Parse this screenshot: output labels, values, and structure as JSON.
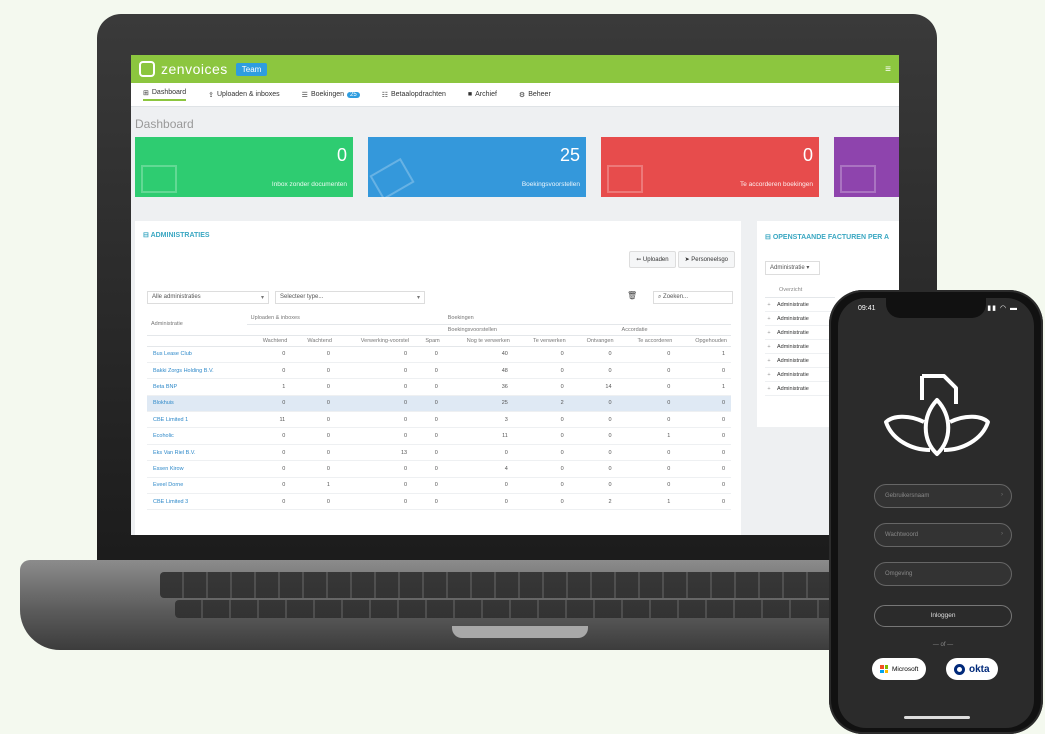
{
  "app": {
    "brand": "zenvoices",
    "env_badge": "Team",
    "menu_icon": "hamburger-icon"
  },
  "nav": {
    "tabs": [
      {
        "label": "Dashboard",
        "icon": "dashboard-icon"
      },
      {
        "label": "Uploaden & inboxes",
        "icon": "upload-icon"
      },
      {
        "label": "Boekingen",
        "icon": "list-icon",
        "badge": "25"
      },
      {
        "label": "Betaalopdrachten",
        "icon": "payment-icon"
      },
      {
        "label": "Archief",
        "icon": "archive-icon"
      },
      {
        "label": "Beheer",
        "icon": "gear-icon"
      }
    ]
  },
  "page": {
    "title": "Dashboard"
  },
  "cards": [
    {
      "value": "0",
      "label": "Inbox zonder documenten",
      "color": "#2ecc71",
      "icon": "envelope-icon"
    },
    {
      "value": "25",
      "label": "Boekingsvoorstellen",
      "color": "#3498db",
      "icon": "pencil-icon"
    },
    {
      "value": "0",
      "label": "Te accorderen boekingen",
      "color": "#e74c4c",
      "icon": "arrow-icon"
    },
    {
      "value": "",
      "label": "",
      "color": "#8e44ad",
      "icon": "expand-icon"
    }
  ],
  "admin_panel": {
    "title": "ADMINISTRATIES",
    "buttons": [
      "Uploaden",
      "Personeelsgo"
    ],
    "filter_admin": "Alle administraties",
    "filter_type": "Selecteer type...",
    "search_placeholder": "Zoeken...",
    "group_headers": {
      "first": "Uploaden & inboxes",
      "second": "Boekingen",
      "sub_left": "Boekingsvoorstellen",
      "sub_right": "Accordatie"
    },
    "columns": [
      "Administratie",
      "Wachtend",
      "Wachtend",
      "Verwerking-voorstel",
      "Spam",
      "Nog te verwerken",
      "Te verwerken",
      "Ontvangen",
      "Te accorderen",
      "Opgehouden"
    ],
    "rows": [
      {
        "name": "Bus Lease Club",
        "values": [
          "0",
          "0",
          "0",
          "0",
          "40",
          "0",
          "0",
          "0",
          "1"
        ]
      },
      {
        "name": "Bakki Zorgs Holding B.V.",
        "values": [
          "0",
          "0",
          "0",
          "0",
          "48",
          "0",
          "0",
          "0",
          "0"
        ]
      },
      {
        "name": "Beta BNP",
        "values": [
          "1",
          "0",
          "0",
          "0",
          "36",
          "0",
          "14",
          "0",
          "1"
        ]
      },
      {
        "name": "Blokhuis",
        "values": [
          "0",
          "0",
          "0",
          "0",
          "25",
          "2",
          "0",
          "0",
          "0"
        ]
      },
      {
        "name": "CBE Limited 1",
        "values": [
          "11",
          "0",
          "0",
          "0",
          "3",
          "0",
          "0",
          "0",
          "0"
        ]
      },
      {
        "name": "Ecoholic",
        "values": [
          "0",
          "0",
          "0",
          "0",
          "11",
          "0",
          "0",
          "1",
          "0"
        ]
      },
      {
        "name": "Eks Van Riel B.V.",
        "values": [
          "0",
          "0",
          "13",
          "0",
          "0",
          "0",
          "0",
          "0",
          "0"
        ]
      },
      {
        "name": "Essen Kirow",
        "values": [
          "0",
          "0",
          "0",
          "0",
          "4",
          "0",
          "0",
          "0",
          "0"
        ]
      },
      {
        "name": "Eveel Dorne",
        "values": [
          "0",
          "1",
          "0",
          "0",
          "0",
          "0",
          "0",
          "0",
          "0"
        ]
      },
      {
        "name": "CBE Limited 3",
        "values": [
          "0",
          "0",
          "0",
          "0",
          "0",
          "0",
          "2",
          "1",
          "0"
        ]
      }
    ]
  },
  "side_panel": {
    "title": "OPENSTAANDE FACTUREN PER A",
    "select": "Administratie",
    "header": "Overzicht",
    "rows": [
      "Administratie",
      "Administratie",
      "Administratie",
      "Administratie",
      "Administratie",
      "Administratie",
      "Administratie"
    ]
  },
  "phone": {
    "time": "09:41",
    "status_icons": "signal-wifi-battery-icons",
    "fields": [
      "Gebruikersnaam",
      "Wachtwoord",
      "Omgeving"
    ],
    "login_label": "Inloggen",
    "or_text": "of",
    "sso_microsoft": "Microsoft",
    "sso_okta": "okta"
  }
}
